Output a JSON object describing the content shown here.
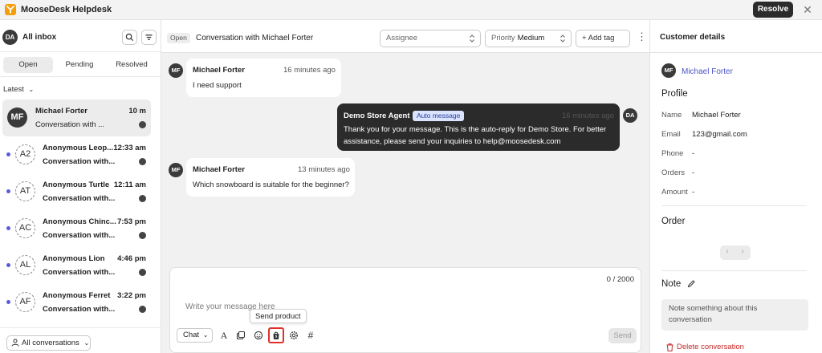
{
  "app": {
    "title": "MooseDesk Helpdesk",
    "resolve_label": "Resolve",
    "close_glyph": "✕"
  },
  "sidebar": {
    "avatar": "DA",
    "title": "All inbox",
    "tabs": [
      "Open",
      "Pending",
      "Resolved"
    ],
    "sort_label": "Latest",
    "conversations": [
      {
        "initials": "MF",
        "name": "Michael Forter",
        "time": "10 m",
        "preview": "Conversation with ...",
        "unread": false
      },
      {
        "initials": "A2",
        "name": "Anonymous Leop...",
        "time": "12:33 am",
        "preview": "Conversation with...",
        "unread": true
      },
      {
        "initials": "AT",
        "name": "Anonymous Turtle",
        "time": "12:11 am",
        "preview": "Conversation with...",
        "unread": true
      },
      {
        "initials": "AC",
        "name": "Anonymous Chinc...",
        "time": "7:53 pm",
        "preview": "Conversation with...",
        "unread": true
      },
      {
        "initials": "AL",
        "name": "Anonymous Lion",
        "time": "4:46 pm",
        "preview": "Conversation with...",
        "unread": true
      },
      {
        "initials": "AF",
        "name": "Anonymous Ferret",
        "time": "3:22 pm",
        "preview": "Conversation with...",
        "unread": true
      }
    ],
    "footer_label": "All conversations"
  },
  "main": {
    "status": "Open",
    "title": "Conversation with Michael Forter",
    "assignee_placeholder": "Assignee",
    "priority_label": "Priority",
    "priority_value": "Medium",
    "add_tag_label": "+ Add tag",
    "messages": [
      {
        "initials": "MF",
        "name": "Michael Forter",
        "time": "16 minutes ago",
        "text": "I need support"
      },
      {
        "initials": "DA",
        "name": "Demo Store Agent",
        "badge": "Auto message",
        "time": "16 minutes ago",
        "text_line1": "Thank you for your message. This is the auto-reply for Demo Store. For better",
        "text_line2": "assistance, please send your inquiries to help@moosedesk.com"
      },
      {
        "initials": "MF",
        "name": "Michael Forter",
        "time": "13 minutes ago",
        "text": "Which snowboard is suitable for the beginner?"
      }
    ],
    "composer": {
      "counter": "0 / 2000",
      "placeholder": "Write your message here",
      "tooltip": "Send product",
      "channel": "Chat",
      "send_label": "Send"
    }
  },
  "details": {
    "title": "Customer details",
    "avatar": "MF",
    "customer_name": "Michael Forter",
    "profile_heading": "Profile",
    "fields": [
      {
        "label": "Name",
        "value": "Michael Forter"
      },
      {
        "label": "Email",
        "value": "123@gmail.com"
      },
      {
        "label": "Phone",
        "value": "-"
      },
      {
        "label": "Orders",
        "value": "-"
      },
      {
        "label": "Amount",
        "value": "-"
      }
    ],
    "order_heading": "Order",
    "note_heading": "Note",
    "note_placeholder_line1": "Note something about this",
    "note_placeholder_line2": "conversation",
    "delete_label": "Delete conversation"
  },
  "colors": {
    "accent": "#5b5bd6",
    "dark": "#2b2b2b",
    "link": "#4c54c9",
    "danger": "#c62828",
    "logo": "#f59e0b"
  }
}
